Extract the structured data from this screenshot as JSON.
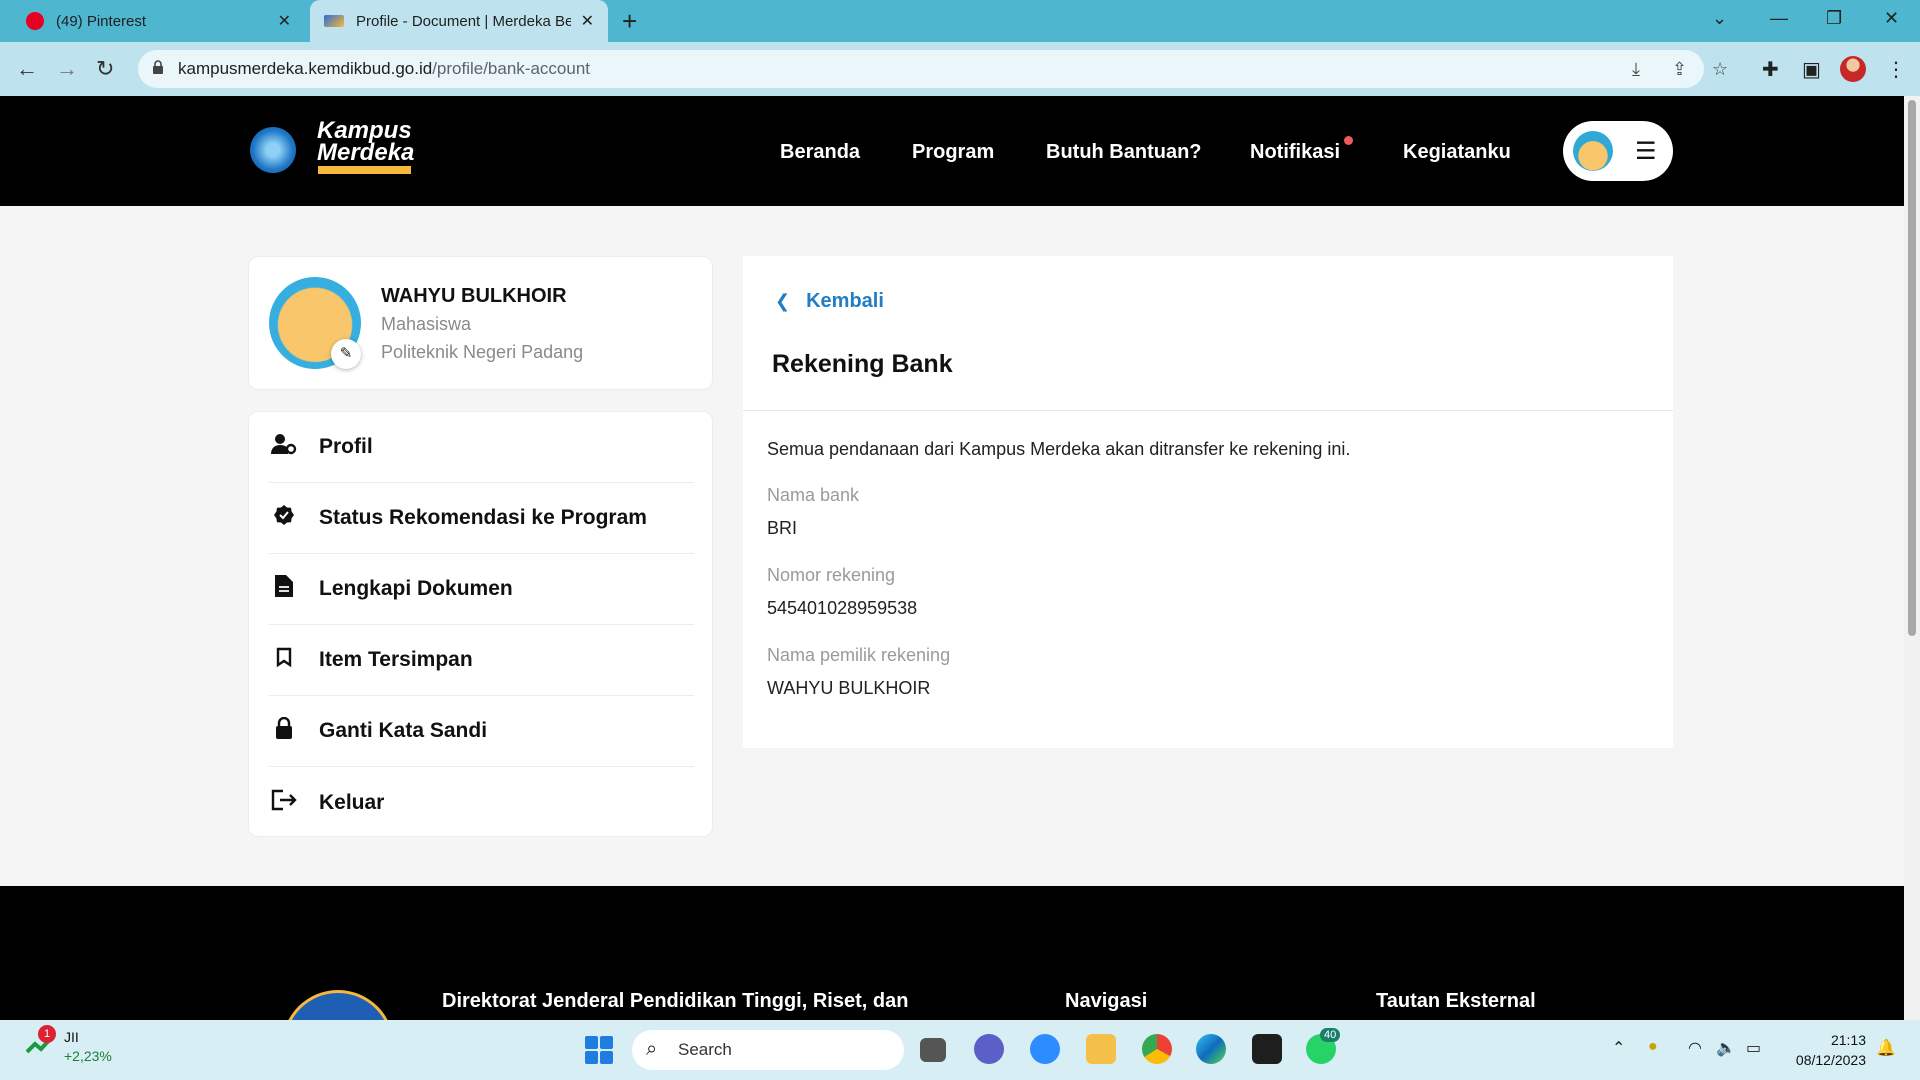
{
  "browser": {
    "tabs": [
      {
        "title": "(49) Pinterest"
      },
      {
        "title": "Profile - Document | Merdeka Be"
      }
    ],
    "new_tab": "+",
    "url_host": "kampusmerdeka.kemdikbud.go.id",
    "url_path": "/profile/bank-account"
  },
  "site": {
    "logo_line1": "Kampus",
    "logo_line2": "Merdeka",
    "nav": [
      "Beranda",
      "Program",
      "Butuh Bantuan?",
      "Notifikasi",
      "Kegiatanku"
    ]
  },
  "profile": {
    "name": "WAHYU BULKHOIR",
    "role": "Mahasiswa",
    "institution": "Politeknik Negeri Padang"
  },
  "sidebar": {
    "items": [
      {
        "label": "Profil",
        "icon": "user-gear-icon"
      },
      {
        "label": "Status Rekomendasi ke Program",
        "icon": "verified-badge-icon"
      },
      {
        "label": "Lengkapi Dokumen",
        "icon": "document-icon"
      },
      {
        "label": "Item Tersimpan",
        "icon": "bookmark-icon"
      },
      {
        "label": "Ganti Kata Sandi",
        "icon": "lock-icon"
      },
      {
        "label": "Keluar",
        "icon": "logout-icon"
      }
    ]
  },
  "main": {
    "back": "Kembali",
    "title": "Rekening Bank",
    "intro": "Semua pendanaan dari Kampus Merdeka akan ditransfer ke rekening ini.",
    "fields": [
      {
        "label": "Nama bank",
        "value": "BRI"
      },
      {
        "label": "Nomor rekening",
        "value": "545401028959538"
      },
      {
        "label": "Nama pemilik rekening",
        "value": "WAHYU BULKHOIR"
      }
    ]
  },
  "footer": {
    "org": "Direktorat Jenderal Pendidikan Tinggi, Riset, dan",
    "nav_heading": "Navigasi",
    "ext_heading": "Tautan Eksternal"
  },
  "taskbar": {
    "stock_name": "JII",
    "stock_change": "+2,23%",
    "notif_count": "1",
    "search": "Search",
    "whatsapp_badge": "40",
    "time": "21:13",
    "date": "08/12/2023"
  },
  "colors": {
    "accent_link": "#1f7ec5",
    "header_bg": "#000000",
    "notif_dot": "#f15a5a",
    "browser_frame": "#4fb6d0"
  }
}
